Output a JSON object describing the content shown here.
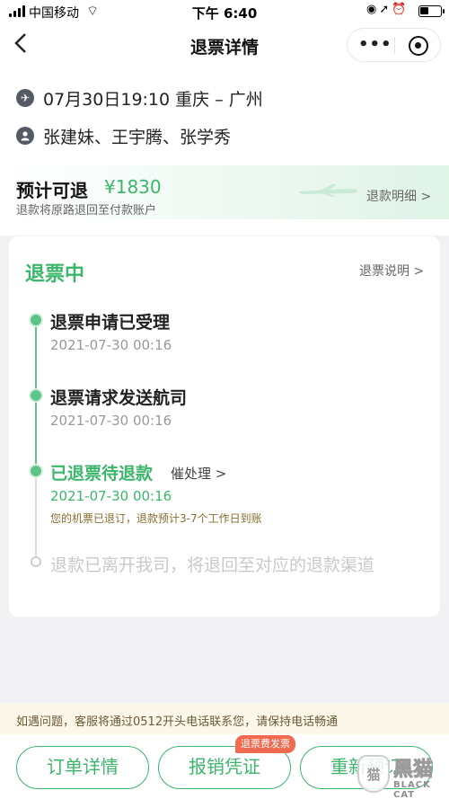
{
  "status_bar": {
    "carrier": "中国移动",
    "time": "下午 6:40",
    "battery_level": 0.45
  },
  "nav": {
    "back_icon": "chevron-left-icon",
    "title": "退票详情",
    "more_icon": "more-dots-icon",
    "close_icon": "target-close-icon"
  },
  "flight": {
    "route": "07月30日19:10 重庆 – 广州",
    "passengers": "张建妹、王宇腾、张学秀"
  },
  "estimate": {
    "label": "预计可退",
    "amount": "¥1830",
    "note": "退款将原路退回至付款账户",
    "detail_link": "退款明细 >"
  },
  "card": {
    "status": "退票中",
    "explain_link": "退票说明 >",
    "steps": [
      {
        "title": "退票申请已受理",
        "time": "2021-07-30 00:16"
      },
      {
        "title": "退票请求发送航司",
        "time": "2021-07-30 00:16"
      },
      {
        "title": "已退票待退款",
        "urge": "催处理 >",
        "time": "2021-07-30 00:16",
        "note": "您的机票已退订，退款预计3-7个工作日到账"
      },
      {
        "title": "退款已离开我司，将退回至对应的退款渠道"
      }
    ]
  },
  "notice": "如遇问题，客服将通过0512开头电话联系您，请保持电话畅通",
  "buttons": {
    "order_detail": "订单详情",
    "reimburse": "报销凭证",
    "reimburse_badge": "退票费发票",
    "rebook": "重新预订"
  },
  "watermark": {
    "zh": "黑猫",
    "en": "BLACK CAT"
  },
  "colors": {
    "accent": "#3cb66b",
    "badge": "#f06a4f"
  }
}
